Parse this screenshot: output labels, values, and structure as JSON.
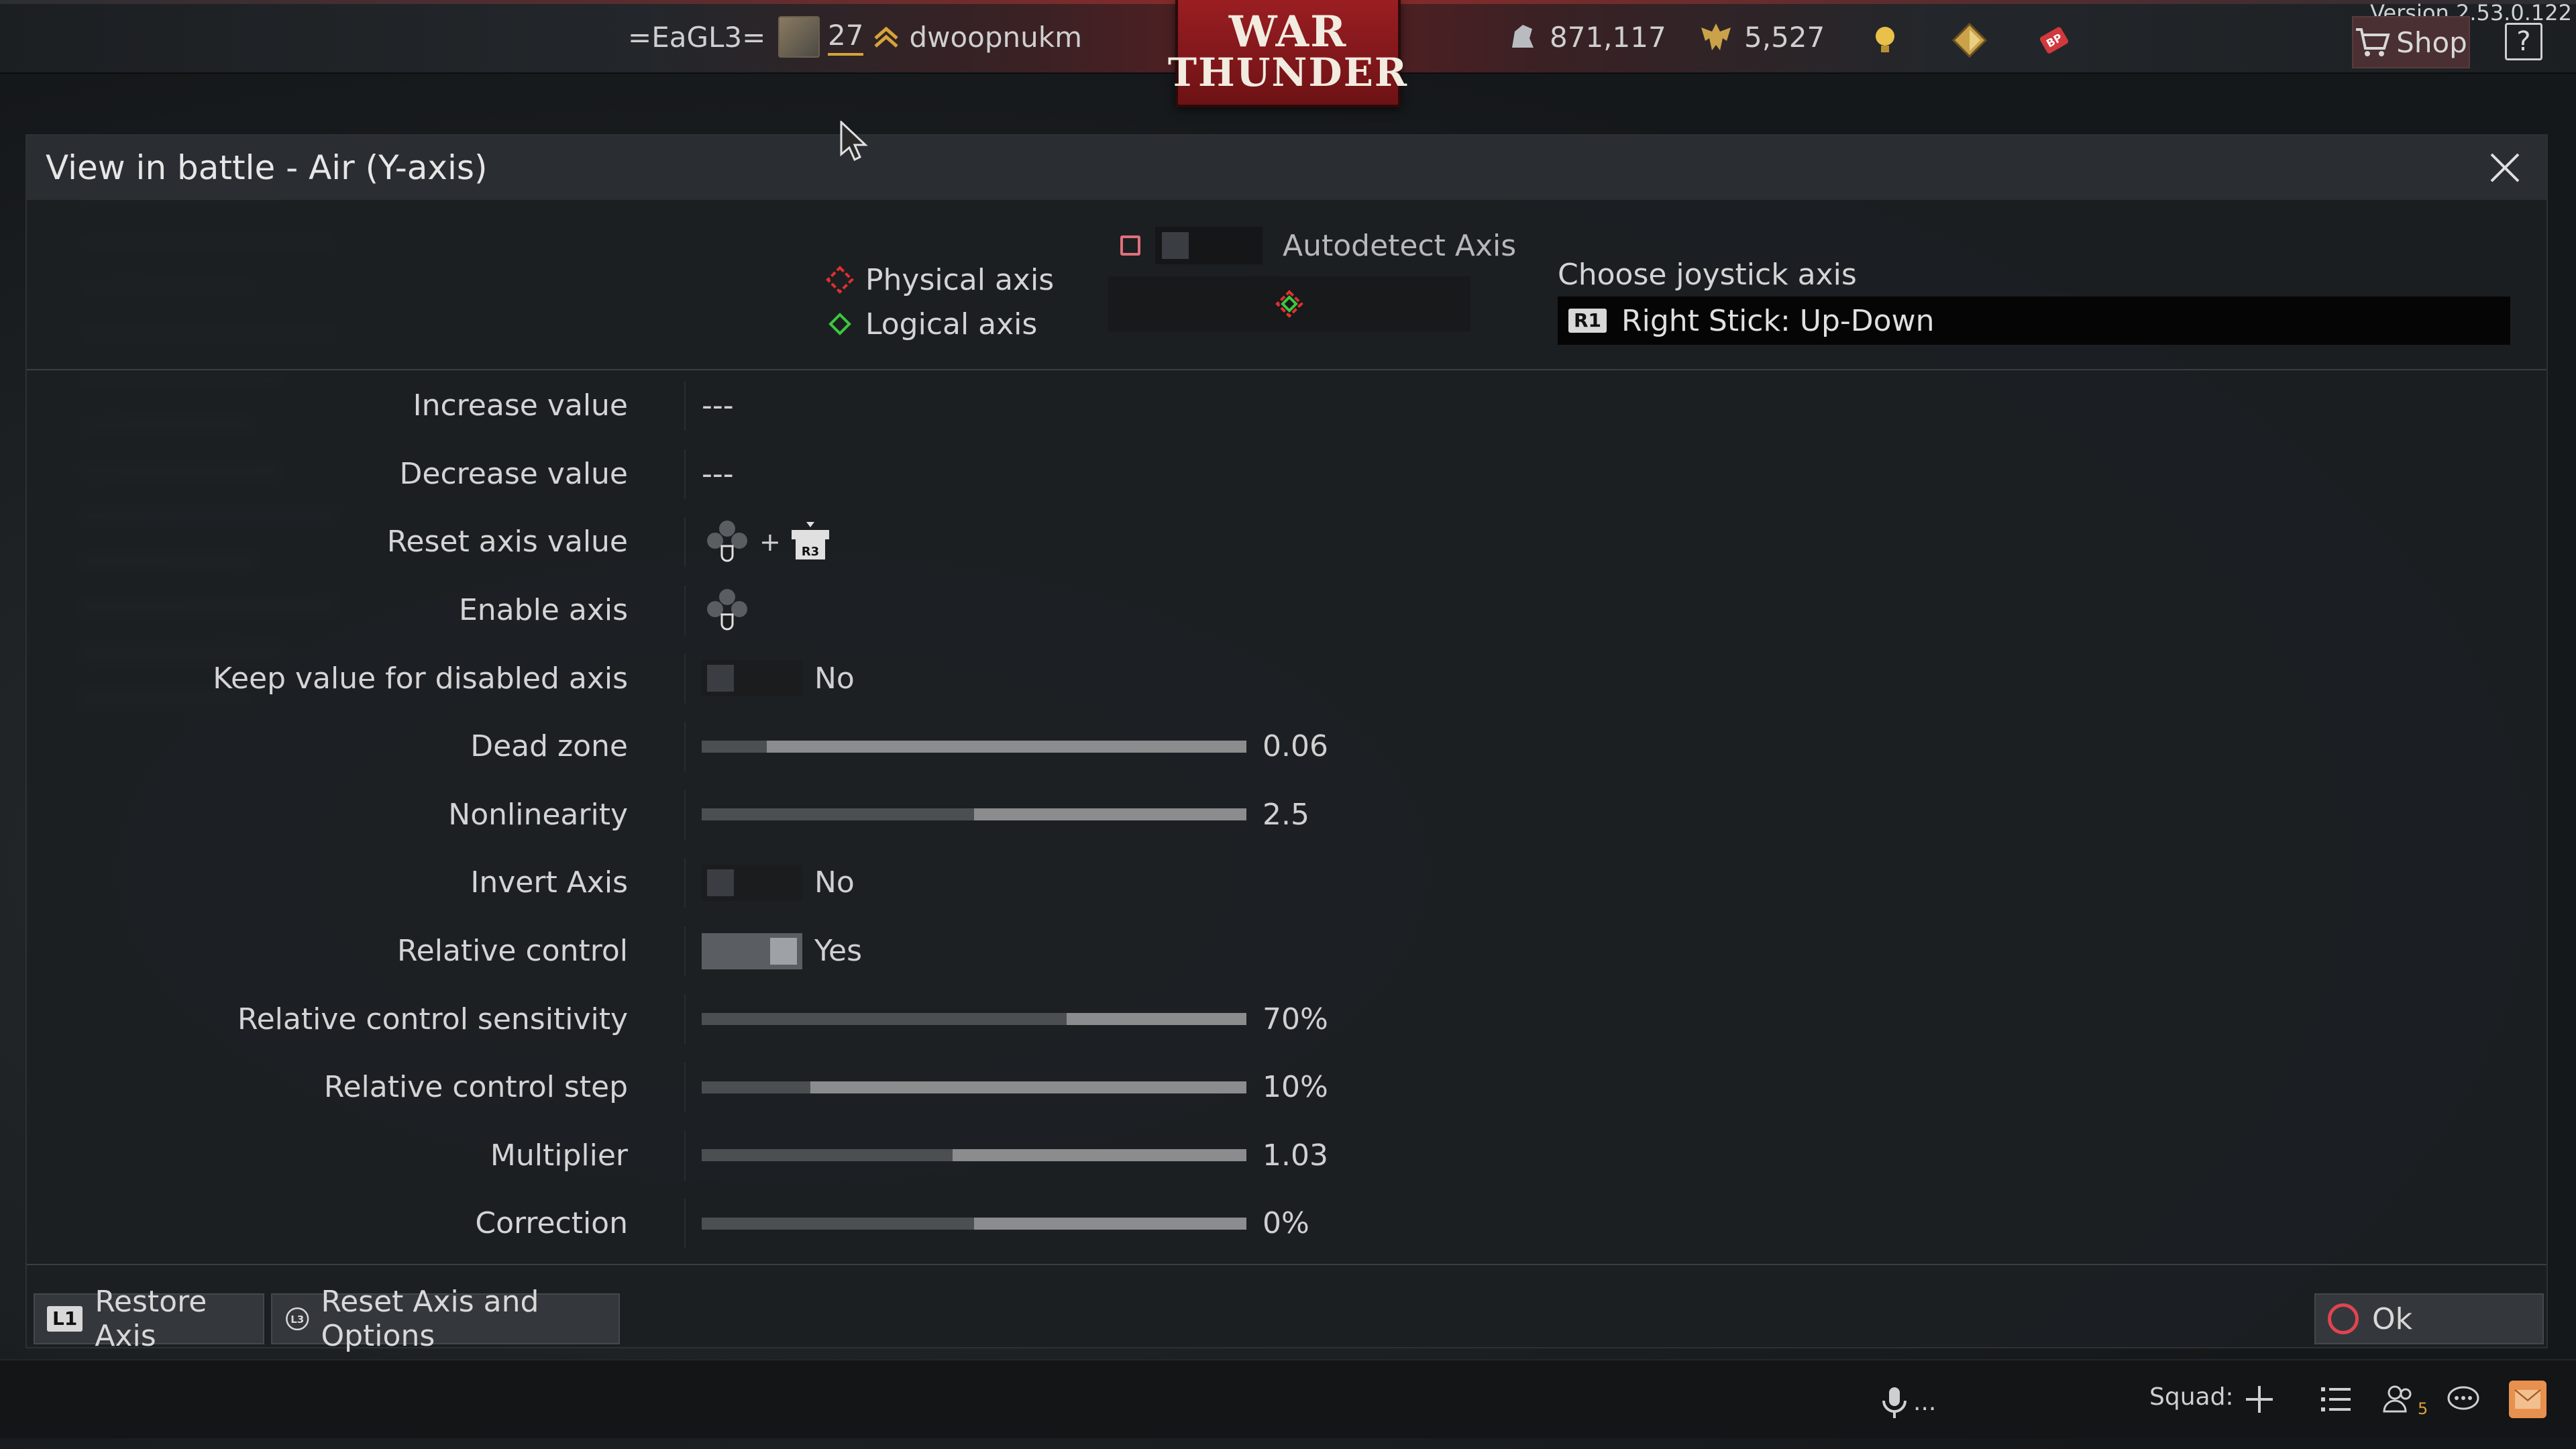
{
  "topbar": {
    "clan_tag": "=EaGL3=",
    "player_level": "27",
    "player_name": "dwoopnukm",
    "logo_line1": "WAR",
    "logo_line2": "THUNDER",
    "silver_lions": "871,117",
    "golden_eagles": "5,527",
    "shop_label": "Shop",
    "help_label": "?",
    "version": "Version 2.53.0.122",
    "icons": [
      "avatar-icon",
      "rank-chevron-icon",
      "silver-lions-icon",
      "golden-eagles-icon",
      "lightbulb-icon",
      "premium-diamond-icon",
      "battle-pass-icon",
      "shop-cart-icon",
      "help-icon"
    ]
  },
  "dialog": {
    "title": "View in battle - Air (Y-axis)",
    "legend": {
      "physical_axis": "Physical axis",
      "logical_axis": "Logical axis"
    },
    "autodetect_label": "Autodetect Axis",
    "joystick": {
      "label": "Choose joystick axis",
      "badge": "R1",
      "selected": "Right Stick: Up-Down"
    },
    "rows": [
      {
        "label": "Increase value",
        "value": "---"
      },
      {
        "label": "Decrease value",
        "value": "---"
      },
      {
        "label": "Reset axis value",
        "plus": "+",
        "key_badge": "R3"
      },
      {
        "label": "Enable axis"
      },
      {
        "label": "Keep value for disabled axis",
        "value": "No",
        "toggle": false
      },
      {
        "label": "Dead zone",
        "value": "0.06",
        "slider": 0.12
      },
      {
        "label": "Nonlinearity",
        "value": "2.5",
        "slider": 0.5
      },
      {
        "label": "Invert Axis",
        "value": "No",
        "toggle": false
      },
      {
        "label": "Relative control",
        "value": "Yes",
        "toggle": true
      },
      {
        "label": "Relative control sensitivity",
        "value": "70%",
        "slider": 0.67
      },
      {
        "label": "Relative control step",
        "value": "10%",
        "slider": 0.2
      },
      {
        "label": "Multiplier",
        "value": "1.03",
        "slider": 0.46
      },
      {
        "label": "Correction",
        "value": "0%",
        "slider": 0.5
      }
    ],
    "footer": {
      "restore_badge": "L1",
      "restore_label": "Restore Axis",
      "reset_badge": "L3",
      "reset_label": "Reset Axis and Options",
      "ok_label": "Ok"
    }
  },
  "bottombar": {
    "voice_label": "...",
    "squad_label": "Squad:",
    "friends_count": "5"
  },
  "colors": {
    "accent_red": "#9a1e22",
    "ok_circle": "#e04450",
    "physical_axis": "#e03030",
    "logical_axis": "#3cc83c",
    "mail": "#e8904e"
  }
}
